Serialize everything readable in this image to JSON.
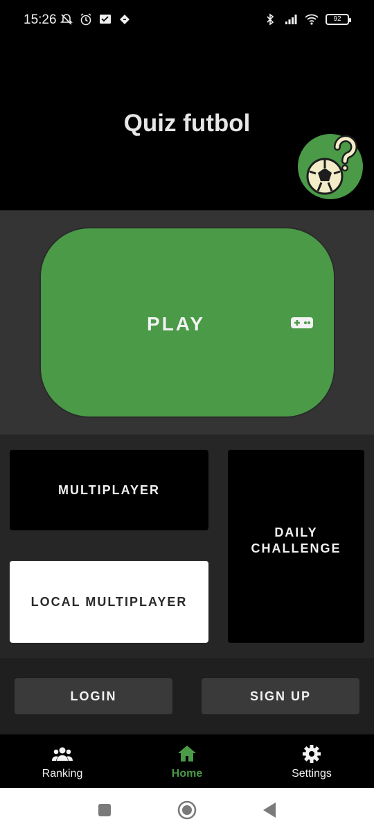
{
  "status_bar": {
    "time": "15:26",
    "battery": "92"
  },
  "header": {
    "title": "Quiz futbol"
  },
  "play": {
    "label": "PLAY"
  },
  "modes": {
    "multiplayer": "MULTIPLAYER",
    "local_multiplayer": "LOCAL MULTIPLAYER",
    "daily_line1": "DAILY",
    "daily_line2": "CHALLENGE"
  },
  "auth": {
    "login": "LOGIN",
    "signup": "SIGN UP"
  },
  "bottom_nav": {
    "items": [
      {
        "label": "Ranking",
        "icon": "group-icon"
      },
      {
        "label": "Home",
        "icon": "home-icon",
        "active": true
      },
      {
        "label": "Settings",
        "icon": "gear-icon"
      }
    ]
  },
  "colors": {
    "accent": "#4a9a48",
    "play_bg": "#4a9a48",
    "section_bg": "#343434"
  }
}
